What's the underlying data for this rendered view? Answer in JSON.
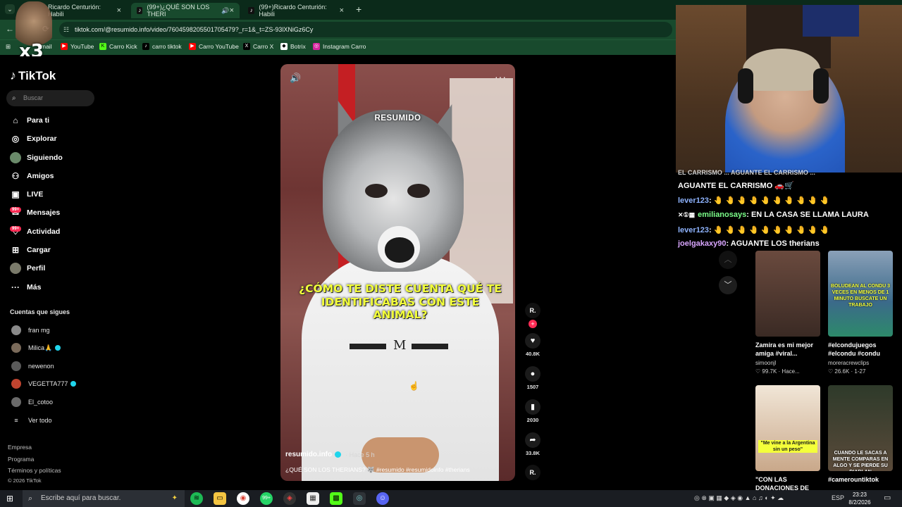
{
  "browser": {
    "tabs": [
      {
        "label": "Ricardo Centurión: Habili",
        "active": false
      },
      {
        "label": "(99+)¿QUÉ SON LOS THERI",
        "active": true
      },
      {
        "label": "(99+)Ricardo Centurión: Habili",
        "active": false
      }
    ],
    "new_tab_icon": "+",
    "url": "tiktok.com/@resumido.info/video/7604598205501705479?_r=1&_t=ZS-93lXNiGz6Cy",
    "bookmarks": [
      {
        "label": "mail",
        "icon": "gmail-icon"
      },
      {
        "label": "YouTube",
        "icon": "youtube-icon"
      },
      {
        "label": "Carro Kick",
        "icon": "kick-icon"
      },
      {
        "label": "carro tiktok",
        "icon": "tiktok-icon"
      },
      {
        "label": "Carro YouTube",
        "icon": "youtube-icon"
      },
      {
        "label": "Carro X",
        "icon": "x-icon"
      },
      {
        "label": "Botrix",
        "icon": "botrix-icon"
      },
      {
        "label": "Instagram Carro",
        "icon": "instagram-icon"
      }
    ]
  },
  "overlay": {
    "multiplier": "x3"
  },
  "sidebar": {
    "brand": "TikTok",
    "search_placeholder": "Buscar",
    "nav": [
      {
        "label": "Para ti",
        "icon": "home-icon"
      },
      {
        "label": "Explorar",
        "icon": "compass-icon"
      },
      {
        "label": "Siguiendo",
        "icon": "following-avatar-icon"
      },
      {
        "label": "Amigos",
        "icon": "friends-icon"
      },
      {
        "label": "LIVE",
        "icon": "live-icon"
      },
      {
        "label": "Mensajes",
        "icon": "messages-icon",
        "badge": "99+"
      },
      {
        "label": "Actividad",
        "icon": "activity-icon",
        "badge": "99+"
      },
      {
        "label": "Cargar",
        "icon": "upload-icon"
      },
      {
        "label": "Perfil",
        "icon": "profile-icon"
      },
      {
        "label": "Más",
        "icon": "more-icon"
      }
    ],
    "following_title": "Cuentas que sigues",
    "following": [
      {
        "name": "fran mg",
        "verified": false,
        "color": "#8a8a8a"
      },
      {
        "name": "Milica🙏",
        "verified": true,
        "color": "#7a6a5a"
      },
      {
        "name": "newenon",
        "verified": false,
        "color": "#5a5a5a"
      },
      {
        "name": "VEGETTA777",
        "verified": true,
        "color": "#c0442f"
      },
      {
        "name": "El_cotoo",
        "verified": false,
        "color": "#6a6a6a"
      }
    ],
    "see_all": "Ver todo",
    "footer": [
      "Empresa",
      "Programa",
      "Términos y políticas",
      "© 2026 TikTok"
    ]
  },
  "video": {
    "watermark": "RESUMIDO",
    "caption": "¿CÓMO TE DISTE CUENTA QUÉ TE IDENTIFICABAS CON ESTE ANIMAL?",
    "author": "resumido.info",
    "time": "· Hace 5 h",
    "description": "¿QUÉ SON LOS THERIANS? 🐺 #resumido #resumidoinfo #therians",
    "likes": "40.8K",
    "comments": "1507",
    "saves": "2030",
    "shares": "33.8K",
    "profile_badge": "R."
  },
  "chat": [
    {
      "user": "",
      "text": "EL CARRISMO ... AGUANTE EL CARRISMO ..."
    },
    {
      "user": "",
      "text": "AGUANTE EL CARRISMO 🚗🛒"
    },
    {
      "user": "lever123",
      "text": ": 🤚 🤚 🤚 🤚 🤚 🤚 🤚 🤚 🤚 🤚"
    },
    {
      "user": "emilianosays",
      "text": ": EN LA CASA SE LLAMA LAURA"
    },
    {
      "user": "lever123",
      "text": ": 🤚 🤚 🤚 🤚 🤚 🤚 🤚 🤚 🤚 🤚"
    },
    {
      "user": "joelgakaxy90",
      "text": ": AGUANTE LOS therians"
    }
  ],
  "related": [
    {
      "title": "Zamira es mi mejor amiga #viral...",
      "user": "simoonjl",
      "stats": "♡ 99.7K · Hace...",
      "thumb_text": ""
    },
    {
      "title": "#elcondujuegos #elcondu #condu",
      "user": "moreracrewclips",
      "stats": "♡ 26.6K · 1-27",
      "thumb_text": "BOLUDEAN AL CONDU 3 VECES EN MENOS DE 1 MINUTO BUSCATE UN TRABAJO"
    },
    {
      "title": "\"CON LAS DONACIONES DE",
      "user": "",
      "stats": "",
      "thumb_text": "\"Me vine a la Argentina sin un peso\""
    },
    {
      "title": "#camerountiktok",
      "user": "",
      "stats": "",
      "thumb_text": "CUANDO LE SACAS A MENTE COMPARAS EN ALGO Y SE PIERDE SU DIABLAN"
    }
  ],
  "taskbar": {
    "search_placeholder": "Escribe aquí para buscar.",
    "language": "ESP",
    "time": "23:23",
    "date": "8/2/2026"
  }
}
